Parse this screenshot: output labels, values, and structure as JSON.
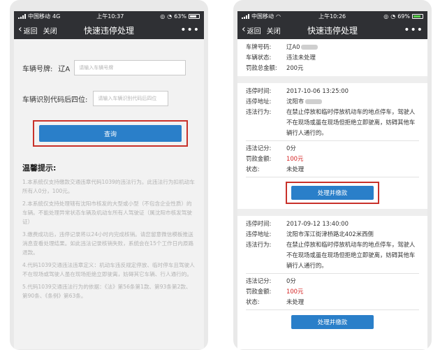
{
  "left": {
    "status": {
      "carrier": "中国移动",
      "network": "4G",
      "time": "上午10:37",
      "battery": "63%",
      "battery_level": 0.63
    },
    "nav": {
      "back_label": "返回",
      "close_label": "关闭",
      "title": "快速违停处理",
      "more": "•••"
    },
    "form": {
      "plate_label": "车辆号牌:",
      "plate_prefix": "辽A",
      "plate_placeholder": "请输入车辆号牌",
      "vin_label": "车辆识别代码后四位:",
      "vin_placeholder": "请输入车辆识别代码后四位",
      "query_label": "查询"
    },
    "tips": {
      "title": "温馨提示:",
      "items": [
        "1.本系统仅支持缴款交通违章代码1039的违法行为。此违法行为扣机动车所有人0分，100元。",
        "2.本系统仅支持处理辖有沈阳市核发的大型或小型（不包含企业性质）的车辆。不能处理异常状态车辆及机动车所有人驾驶证（属沈阳市核发驾驶证）",
        "3.缴费成功后，违停记录将以24小时内完成核销。请您留意微信模板推送消息查看处理结果。如此违法记录核销失败，系统会在15个工作日内原路退款。",
        "4.代码1039交通违法违章定义：机动车违反规定停放、临时停车且驾驶人不在现场或驾驶人虽在现场拒绝立即驶离，妨碍其它车辆、行人通行的。",
        "5.代码1039交通违法行为的依据：《法》第56条第1款、第93条第2款、第90条、《条例》第63条。"
      ]
    }
  },
  "right": {
    "status": {
      "carrier": "中国移动",
      "time": "上午10:26",
      "battery": "69%",
      "battery_level": 0.69
    },
    "nav": {
      "back_label": "返回",
      "close_label": "关闭",
      "title": "快速违停处理",
      "more": "•••"
    },
    "summary": [
      {
        "k": "车牌号码:",
        "v": "辽A0"
      },
      {
        "k": "车辆状态:",
        "v": "违法未处理"
      },
      {
        "k": "罚款总金额:",
        "v": "200元"
      }
    ],
    "records": [
      {
        "time_k": "违停时间:",
        "time_v": "2017-10-06 13:25:00",
        "place_k": "违停地址:",
        "place_v": "沈阳市",
        "act_k": "违法行为:",
        "act_v": "在禁止停放和临时停放机动车的地点停车，驾驶人不在现场或虽在现场但拒绝立即驶离，妨碍其他车辆行人通行的。",
        "pts_k": "违法记分:",
        "pts_v": "0分",
        "fine_k": "罚款金额:",
        "fine_v": "100元",
        "state_k": "状态:",
        "state_v": "未处理",
        "btn": "处理并缴款"
      },
      {
        "time_k": "违停时间:",
        "time_v": "2017-09-12 13:40:00",
        "place_k": "违停地址:",
        "place_v": "沈阳市浑江街津桥路北402米西侧",
        "act_k": "违法行为:",
        "act_v": "在禁止停放和临时停放机动车的地点停车，驾驶人不在现场或虽在现场但拒绝立即驶离，妨碍其他车辆行人通行的。",
        "pts_k": "违法记分:",
        "pts_v": "0分",
        "fine_k": "罚款金额:",
        "fine_v": "100元",
        "state_k": "状态:",
        "state_v": "未处理",
        "btn": "处理并缴款"
      }
    ]
  },
  "colors": {
    "navbar": "#2f3034",
    "primary_button": "#2a7fc9",
    "highlight_border": "#c8312a",
    "fine_red": "#d42222"
  }
}
